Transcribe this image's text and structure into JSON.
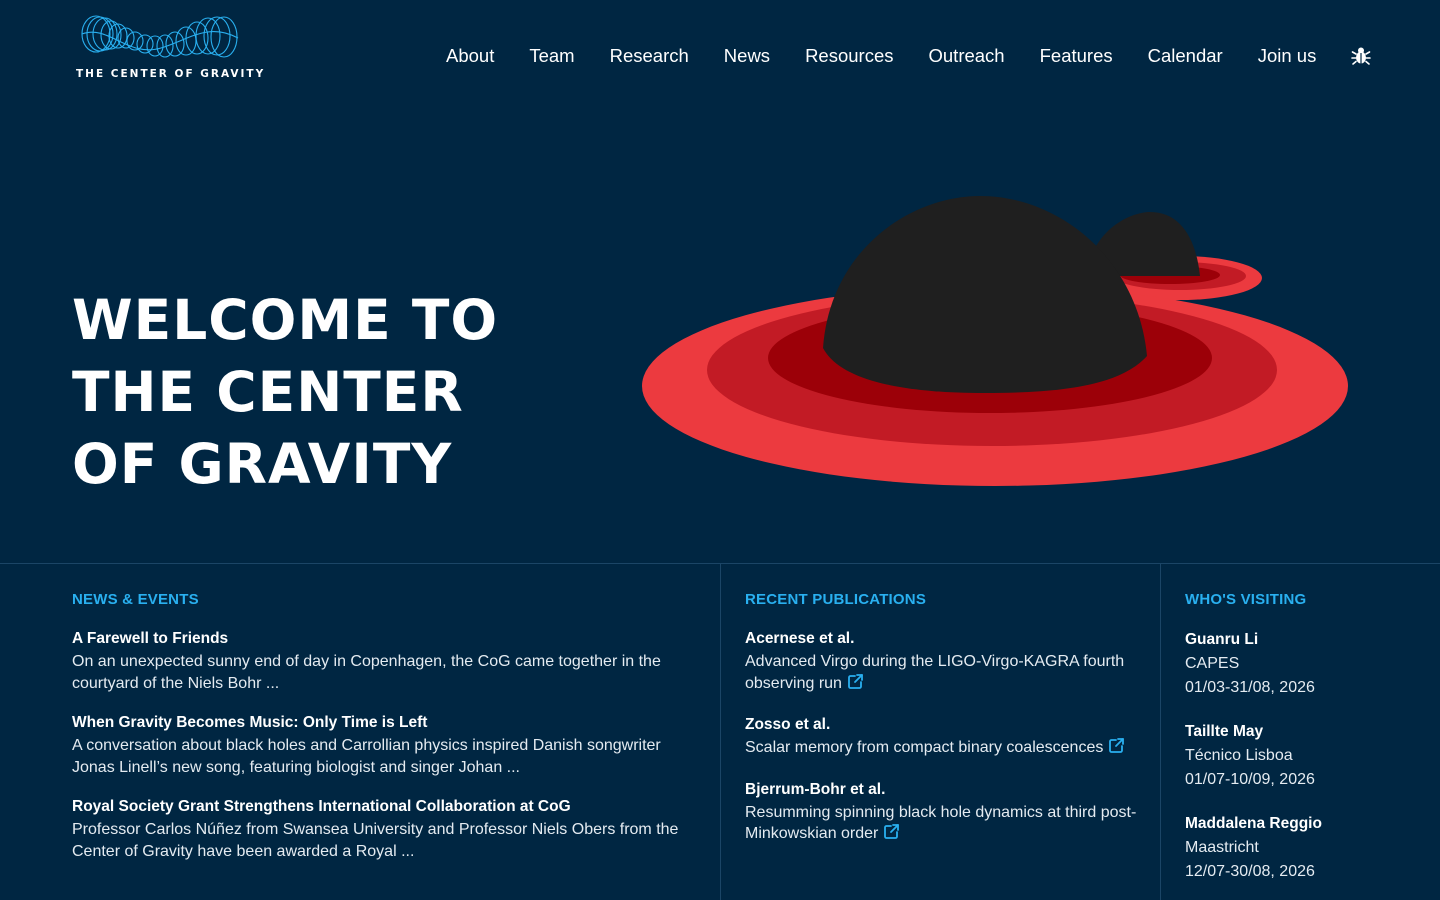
{
  "brand": {
    "logo_text": "THE CENTER OF GRAVITY"
  },
  "nav": {
    "items": [
      "About",
      "Team",
      "Research",
      "News",
      "Resources",
      "Outreach",
      "Features",
      "Calendar",
      "Join us"
    ],
    "extra_icon": "bug-icon"
  },
  "hero": {
    "title_lines": [
      "WELCOME TO",
      "THE CENTER",
      "OF GRAVITY"
    ]
  },
  "news": {
    "title": "NEWS & EVENTS",
    "items": [
      {
        "title": "A Farewell to Friends",
        "body": "On an unexpected sunny end of day in Copenhagen, the CoG came together in the courtyard of the Niels Bohr ..."
      },
      {
        "title": "When Gravity Becomes Music: Only Time is Left",
        "body": "A conversation about black holes and Carrollian physics inspired Danish songwriter Jonas Linell’s new song, featuring biologist and singer Johan ..."
      },
      {
        "title": "Royal Society Grant Strengthens International Collaboration at CoG",
        "body": "Professor Carlos Núñez from Swansea University and Professor Niels Obers from the Center of Gravity have been awarded a Royal ..."
      }
    ]
  },
  "publications": {
    "title": "RECENT PUBLICATIONS",
    "items": [
      {
        "authors": "Acernese et al.",
        "title": "Advanced Virgo during the LIGO-Virgo-KAGRA fourth observing run"
      },
      {
        "authors": "Zosso et al.",
        "title": "Scalar memory from compact binary coalescences"
      },
      {
        "authors": "Bjerrum-Bohr et al.",
        "title": "Resumming spinning black hole dynamics at third post-Minkowskian order"
      }
    ],
    "link_icon": "external-link-icon"
  },
  "visitors": {
    "title": "WHO'S VISITING",
    "items": [
      {
        "name": "Guanru Li",
        "affiliation": "CAPES",
        "dates": "01/03-31/08, 2026"
      },
      {
        "name": "Taillte May",
        "affiliation": "Técnico Lisboa",
        "dates": "01/07-10/09, 2026"
      },
      {
        "name": "Maddalena Reggio",
        "affiliation": "Maastricht",
        "dates": "12/07-30/08, 2026"
      }
    ]
  },
  "colors": {
    "background": "#002642",
    "accent": "#29b0f0",
    "ring_outer": "#ec3a3f",
    "ring_mid": "#c21b25",
    "ring_inner": "#9c0008",
    "hole": "#1f1f1f"
  }
}
